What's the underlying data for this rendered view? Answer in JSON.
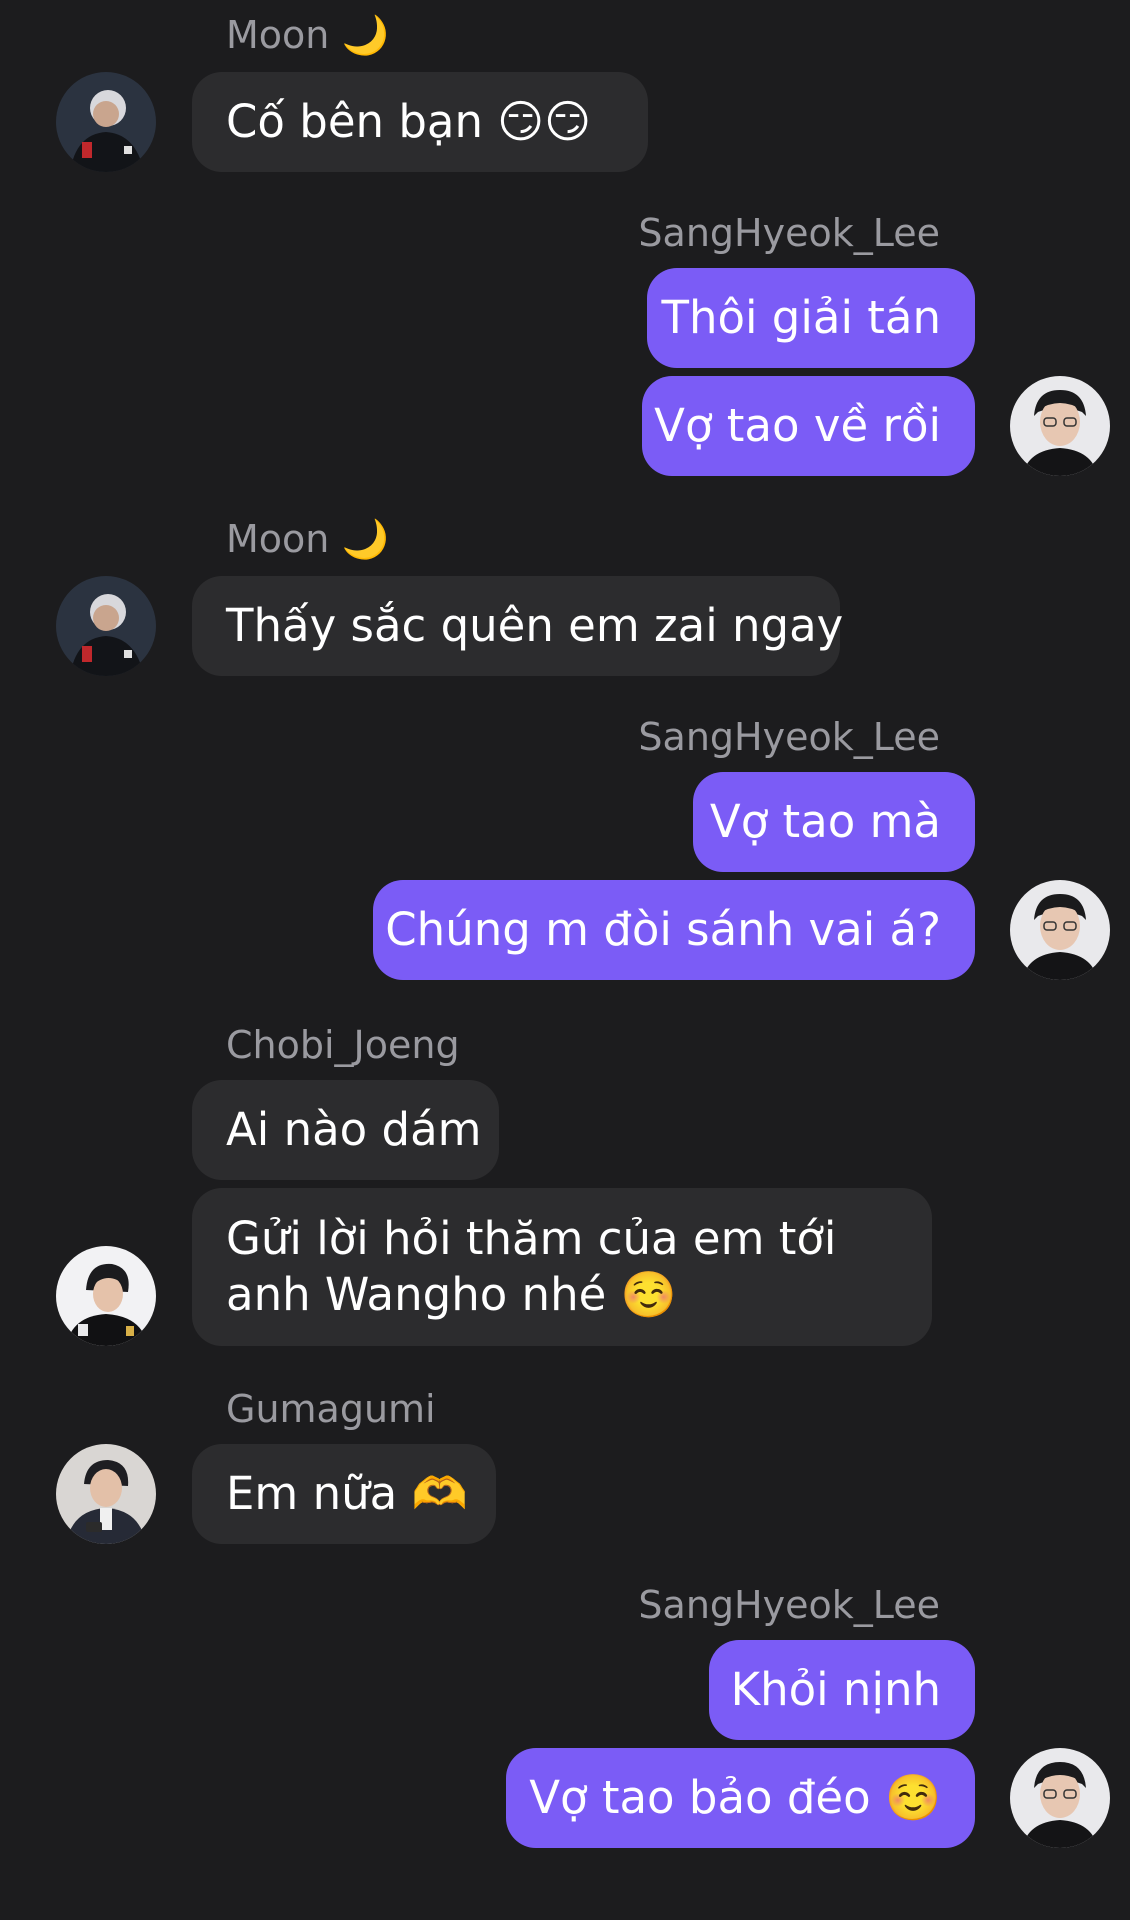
{
  "messages": {
    "m1_sender": "Moon 🌙",
    "m1_text": "Cố bên bạn 😏😏",
    "m2_sender": "SangHyeok_Lee",
    "m2_text1": "Thôi giải tán",
    "m2_text2": "Vợ tao về rồi",
    "m3_sender": "Moon 🌙",
    "m3_text": "Thấy sắc quên em zai ngay",
    "m4_sender": "SangHyeok_Lee",
    "m4_text1": "Vợ tao mà",
    "m4_text2": "Chúng m đòi sánh vai á?",
    "m5_sender": "Chobi_Joeng",
    "m5_text1": "Ai nào dám",
    "m5_text2": "Gửi lời hỏi thăm của em tới anh Wangho nhé ☺️",
    "m6_sender": "Gumagumi",
    "m6_text": "Em nữa 🫶",
    "m7_sender": "SangHyeok_Lee",
    "m7_text1": "Khỏi nịnh",
    "m7_text2": "Vợ tao bảo đéo ☺️"
  },
  "colors": {
    "background": "#1c1c1e",
    "incoming_bubble": "#2c2c2e",
    "outgoing_bubble": "#7b5cf6",
    "sender_name": "#9a9aa0"
  }
}
